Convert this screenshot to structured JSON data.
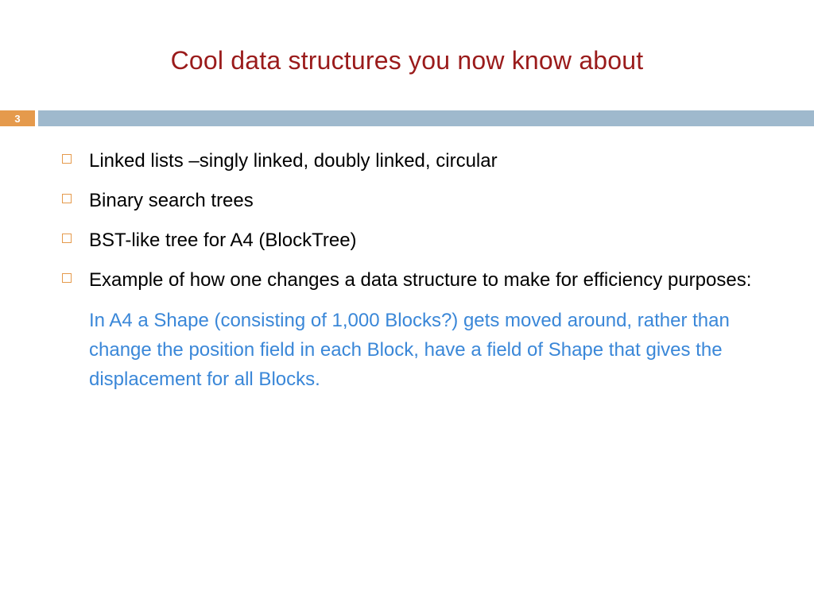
{
  "title": "Cool data structures you now know about",
  "pageNumber": "3",
  "bullets": [
    "Linked lists –singly linked, doubly linked, circular",
    "Binary search trees",
    "BST-like tree for A4 (BlockTree)",
    "Example of how one changes a data structure to make for efficiency purposes:"
  ],
  "subText": "In A4 a Shape (consisting of 1,000 Blocks?) gets moved around, rather than change the position field in each Block, have a field of Shape that gives the displacement for all Blocks."
}
